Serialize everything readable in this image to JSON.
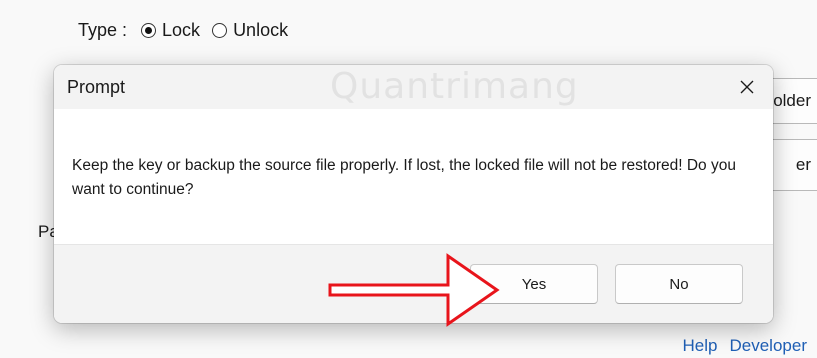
{
  "background": {
    "type_label": "Type :",
    "options": [
      {
        "label": "Lock",
        "checked": true
      },
      {
        "label": "Unlock",
        "checked": false
      }
    ],
    "btn1_label": "older",
    "btn2_label": "er",
    "partial_label": "Pa",
    "links": {
      "help": "Help",
      "developer": "Developer"
    }
  },
  "dialog": {
    "title": "Prompt",
    "close_glyph": "✕",
    "message": "Keep the key or backup the source file properly. If lost, the locked file will not be restored! Do you want to continue?",
    "buttons": {
      "yes": "Yes",
      "no": "No"
    }
  },
  "watermark": {
    "text": "Quantrimang"
  },
  "colors": {
    "arrow": "#e8141b",
    "link": "#1f5fb5",
    "dialog_bg": "#ffffff",
    "footer_bg": "#f3f3f3"
  }
}
